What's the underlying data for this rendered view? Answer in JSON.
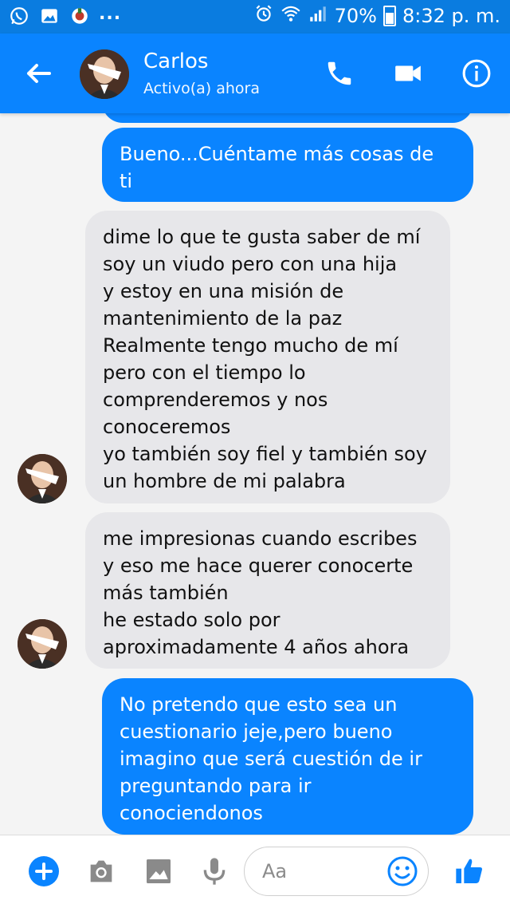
{
  "status_bar": {
    "battery": "70%",
    "time": "8:32 p. m.",
    "more_indicator": "...",
    "icons": [
      "whatsapp-icon",
      "gallery-icon",
      "app-icon",
      "alarm-icon",
      "wifi-icon",
      "signal-icon",
      "battery-icon"
    ]
  },
  "header": {
    "contact_name": "Carlos",
    "contact_status": "Activo(a) ahora",
    "icons": [
      "back-arrow-icon",
      "phone-icon",
      "video-camera-icon",
      "info-icon"
    ]
  },
  "messages": [
    {
      "direction": "out",
      "lines": [
        "Bueno...Cuéntame más cosas de",
        "ti"
      ]
    },
    {
      "direction": "in",
      "lines": [
        "dime lo que te gusta saber de mí",
        "soy un viudo pero con una hija",
        "y estoy en una misión de",
        "mantenimiento de la paz",
        "Realmente tengo mucho de mí",
        "pero con el tiempo lo",
        "comprenderemos y nos",
        "conoceremos",
        "yo también soy fiel y también soy",
        "un hombre de mi palabra"
      ]
    },
    {
      "direction": "in",
      "lines": [
        "me impresionas cuando escribes",
        "y eso me hace querer conocerte",
        "más también",
        "he estado solo por",
        "aproximadamente 4 años ahora"
      ]
    },
    {
      "direction": "out",
      "lines": [
        "No pretendo que esto sea un",
        "cuestionario jeje,pero bueno",
        "imagino que será cuestión de ir",
        "preguntando para ir",
        "conociendonos"
      ]
    }
  ],
  "composer": {
    "placeholder": "Aa",
    "icons": [
      "plus-icon",
      "camera-icon",
      "image-icon",
      "microphone-icon",
      "emoji-icon",
      "thumbs-up-icon"
    ]
  },
  "colors": {
    "accent": "#0a84ff",
    "status_bar": "#0a7ce0",
    "incoming_bubble": "#e7e7ea",
    "chat_background": "#f4f4f4"
  }
}
